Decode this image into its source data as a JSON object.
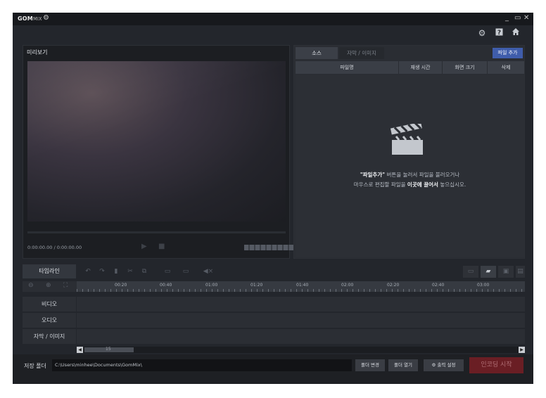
{
  "app": {
    "logo_main": "GOM",
    "logo_sub": "MIX"
  },
  "icons": {
    "gear": "gear-icon",
    "minimize": "minimize-icon",
    "maximize": "maximize-icon",
    "close": "close-icon",
    "help": "help-icon",
    "home": "home-icon",
    "clapper": "clapperboard-icon"
  },
  "preview": {
    "title": "미리보기",
    "timecode": "0:00:00.00 / 0:00:00.00"
  },
  "source": {
    "tabs": [
      "소스",
      "자막 / 이미지"
    ],
    "add_button": "파일 추가",
    "columns": [
      "파일명",
      "재생 시간",
      "화면 크기",
      "삭제"
    ],
    "hint_line1_bold": "\"파일추가\"",
    "hint_line1_rest": " 버튼을 눌러서 파일을 불러오거나",
    "hint_line2_pre": "마우스로 편집할 파일을 ",
    "hint_line2_bold": "이곳에 끌어서",
    "hint_line2_post": " 놓으십시오."
  },
  "timeline": {
    "label": "타임라인",
    "ticks": [
      "00:20",
      "00:40",
      "01:00",
      "01:20",
      "01:40",
      "02:00",
      "02:20",
      "02:40",
      "03:00"
    ],
    "tracks": [
      "비디오",
      "오디오",
      "자막 / 이미지"
    ],
    "scroll_thumb_text": "15"
  },
  "bottom": {
    "save_folder_label": "저장 폴더",
    "save_path": "C:\\Users\\minhee\\Documents\\GomMix\\",
    "change_folder": "폴더 변경",
    "open_folder": "폴더 열기",
    "output_settings": "출력 설정",
    "encode_start": "인코딩 시작"
  },
  "colors": {
    "accent": "#3f5dab",
    "encode": "#6a1e24",
    "background": "#23262c"
  }
}
